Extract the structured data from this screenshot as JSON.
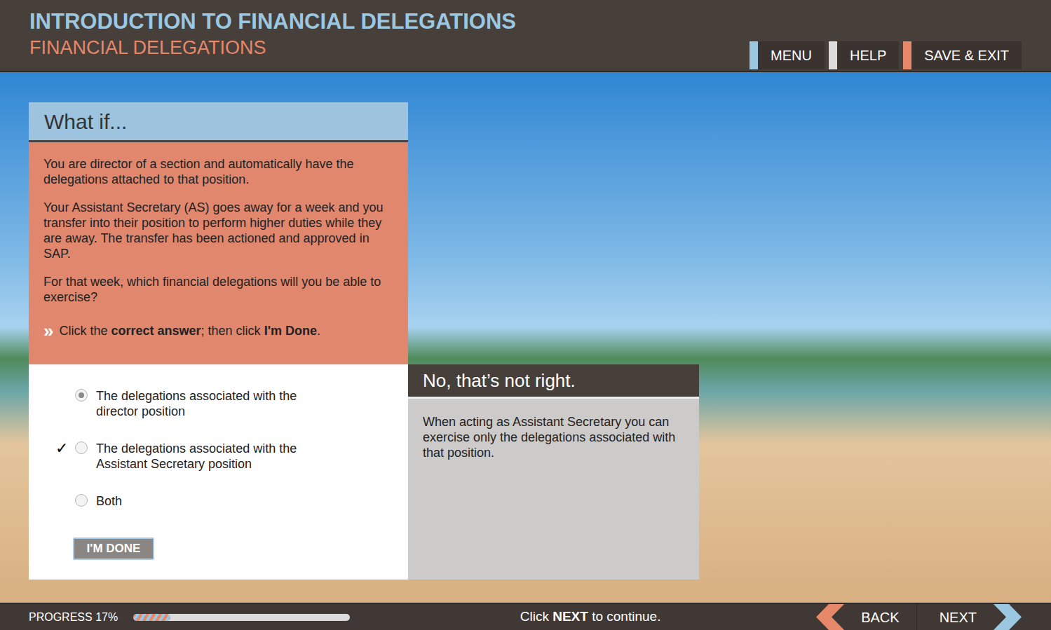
{
  "header": {
    "title": "INTRODUCTION TO FINANCIAL DELEGATIONS",
    "subtitle": "FINANCIAL DELEGATIONS"
  },
  "nav": [
    {
      "label": "MENU",
      "color": "#9cc7e0"
    },
    {
      "label": "HELP",
      "color": "#dcdcdc"
    },
    {
      "label": "SAVE & EXIT",
      "color": "#e8886b"
    }
  ],
  "question": {
    "title": "What if...",
    "paragraphs": [
      "You are director of a section and automatically have the delegations attached to that position.",
      "Your Assistant Secretary (AS) goes away for a week and you transfer into their position to perform higher duties while they are away. The transfer has been actioned and approved in SAP.",
      "For that week, which financial delegations will you be able to exercise?"
    ],
    "instruction": {
      "marker": "»",
      "before": "Click the ",
      "bold1": "correct answer",
      "middle": "; then click ",
      "bold2": "I'm Done",
      "after": "."
    },
    "correct_mark": "✓",
    "options": [
      {
        "label": "The delegations associated with the director position",
        "selected": true,
        "correct": false
      },
      {
        "label": "The delegations associated with the Assistant Secretary position",
        "selected": false,
        "correct": true
      },
      {
        "label": "Both",
        "selected": false,
        "correct": false
      }
    ],
    "submit": "I'M DONE"
  },
  "feedback": {
    "title": "No, that’s not right.",
    "body": "When acting as Assistant Secretary you can exercise only the delegations associated with that position."
  },
  "footer": {
    "progress_label": "PROGRESS 17%",
    "progress": {
      "level": 0.17
    },
    "hint_before": "Click ",
    "hint_bold": "NEXT",
    "hint_after": " to continue.",
    "back": "BACK",
    "next": "NEXT"
  }
}
